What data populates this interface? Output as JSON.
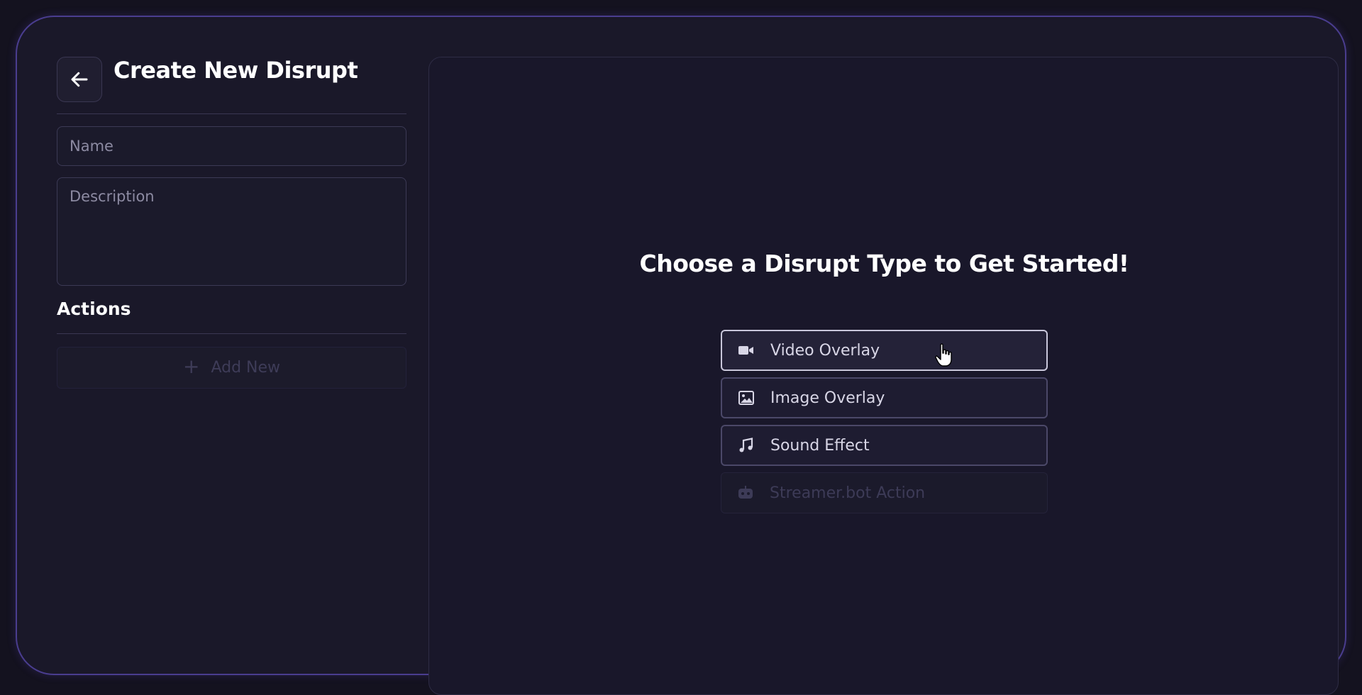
{
  "header": {
    "title": "Create New Disrupt",
    "back_icon": "arrow-left-icon"
  },
  "form": {
    "name_placeholder": "Name",
    "name_value": "",
    "description_placeholder": "Description",
    "description_value": ""
  },
  "actions": {
    "heading": "Actions",
    "add_new_label": "Add New",
    "add_new_icon": "plus-icon"
  },
  "main": {
    "title": "Choose a Disrupt Type to Get Started!",
    "types": [
      {
        "label": "Video Overlay",
        "icon": "video-camera-icon",
        "state": "hovered"
      },
      {
        "label": "Image Overlay",
        "icon": "image-icon",
        "state": "normal"
      },
      {
        "label": "Sound Effect",
        "icon": "music-note-icon",
        "state": "normal"
      },
      {
        "label": "Streamer.bot Action",
        "icon": "robot-icon",
        "state": "disabled"
      }
    ]
  },
  "colors": {
    "background": "#14121f",
    "window_border": "#4a3d8f",
    "panel_background": "#1a1829",
    "text_primary": "#ffffff",
    "text_muted": "#8c8aa2",
    "disabled_text": "#3d3b57"
  }
}
